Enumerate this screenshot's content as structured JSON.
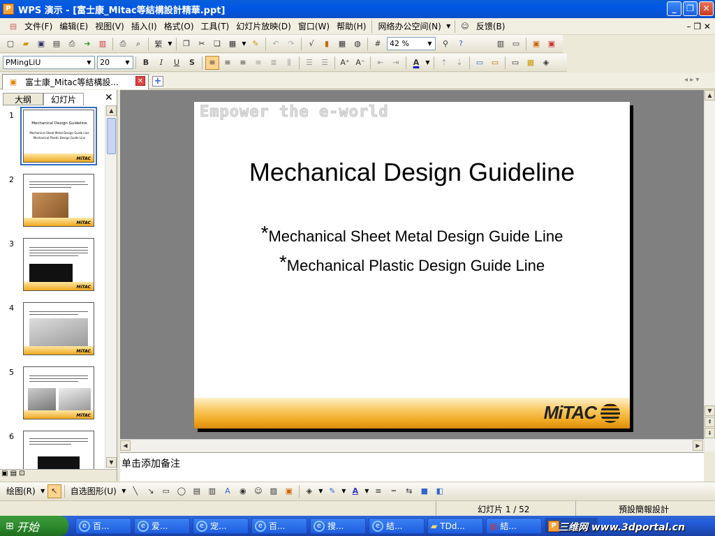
{
  "window": {
    "title": "WPS 演示 - [富士康_Mitac等結構設計精華.ppt]",
    "app_icon": "P"
  },
  "menu": [
    "文件(F)",
    "编辑(E)",
    "视图(V)",
    "插入(I)",
    "格式(O)",
    "工具(T)",
    "幻灯片放映(D)",
    "窗口(W)",
    "帮助(H)",
    "网络办公空间(N)",
    "反馈(B)"
  ],
  "toolbar": {
    "zoom": "42 %",
    "traditional": "繁"
  },
  "format": {
    "font": "PMingLiU",
    "size": "20",
    "bold": "B",
    "italic": "I",
    "underline": "U",
    "shadow": "S"
  },
  "doc_tab": {
    "label": "富士康_Mitac等結構設..."
  },
  "panel": {
    "tab_outline": "大纲",
    "tab_slides": "幻灯片"
  },
  "thumbnails": [
    {
      "num": "1",
      "title": "Mechanical Design Guideline",
      "line1": "Mechanical Sheet Metal Design Guide Line",
      "line2": "Mechanical Plastic Design Guide Line"
    },
    {
      "num": "2"
    },
    {
      "num": "3"
    },
    {
      "num": "4"
    },
    {
      "num": "5"
    },
    {
      "num": "6"
    }
  ],
  "slide": {
    "watermark": "Empower the e-world",
    "title": "Mechanical Design Guideline",
    "bullets": [
      "Mechanical Sheet Metal Design Guide Line",
      "Mechanical Plastic Design Guide Line"
    ],
    "bullet_mark": "*",
    "logo": "MiTAC"
  },
  "notes": {
    "placeholder": "单击添加备注"
  },
  "drawbar": {
    "draw_label": "绘图(R)",
    "autoshape_label": "自选图形(U)"
  },
  "status": {
    "slide": "幻灯片 1 / 52",
    "template": "預設簡報設計"
  },
  "taskbar": {
    "start": "开始",
    "tasks": [
      "百...",
      "爱...",
      "宠...",
      "百...",
      "搜...",
      "結...",
      "TDd...",
      "結..."
    ],
    "watermark": "三维网 www.3dportal.cn"
  },
  "colors": {
    "title_bar": "#0058e6",
    "slide_footer": "#f0a820",
    "workspace": "#808080"
  }
}
